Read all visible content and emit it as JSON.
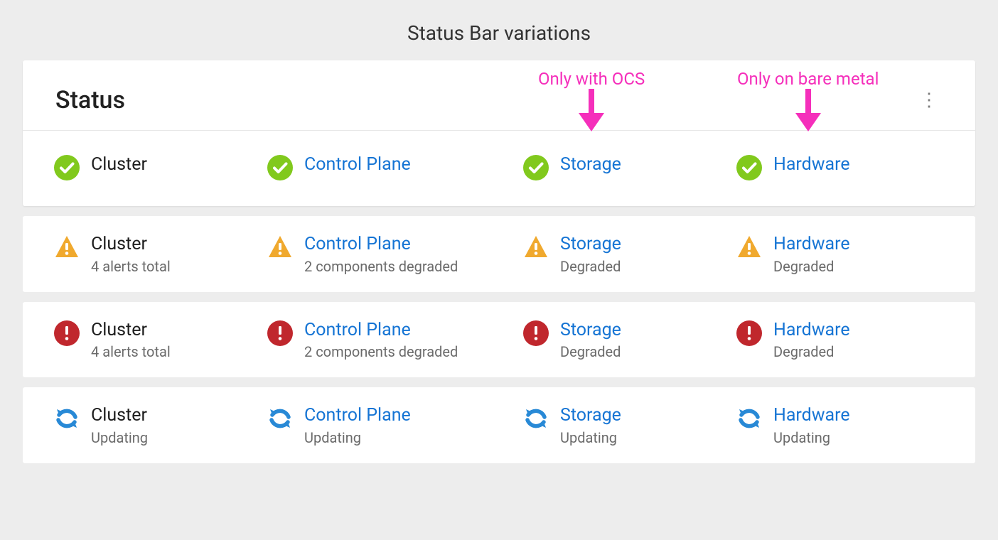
{
  "page_title": "Status Bar variations",
  "header": {
    "title": "Status"
  },
  "annotations": {
    "ocs": "Only with OCS",
    "bare_metal": "Only on bare metal"
  },
  "columns": [
    {
      "label": "Cluster",
      "link": false
    },
    {
      "label": "Control Plane",
      "link": true
    },
    {
      "label": "Storage",
      "link": true
    },
    {
      "label": "Hardware",
      "link": true
    }
  ],
  "rows": [
    {
      "icon": "check",
      "items": [
        {
          "sub": ""
        },
        {
          "sub": ""
        },
        {
          "sub": ""
        },
        {
          "sub": ""
        }
      ]
    },
    {
      "icon": "warning",
      "items": [
        {
          "sub": "4 alerts total"
        },
        {
          "sub": "2 components degraded"
        },
        {
          "sub": "Degraded"
        },
        {
          "sub": "Degraded"
        }
      ]
    },
    {
      "icon": "error",
      "items": [
        {
          "sub": "4 alerts total"
        },
        {
          "sub": "2 components degraded"
        },
        {
          "sub": "Degraded"
        },
        {
          "sub": "Degraded"
        }
      ]
    },
    {
      "icon": "updating",
      "items": [
        {
          "sub": "Updating"
        },
        {
          "sub": "Updating"
        },
        {
          "sub": "Updating"
        },
        {
          "sub": "Updating"
        }
      ]
    }
  ],
  "colors": {
    "check": "#81c91d",
    "warning": "#f0a92e",
    "error": "#c0272d",
    "updating": "#2889d6",
    "link": "#1574d4",
    "annotation": "#f52fbb"
  }
}
